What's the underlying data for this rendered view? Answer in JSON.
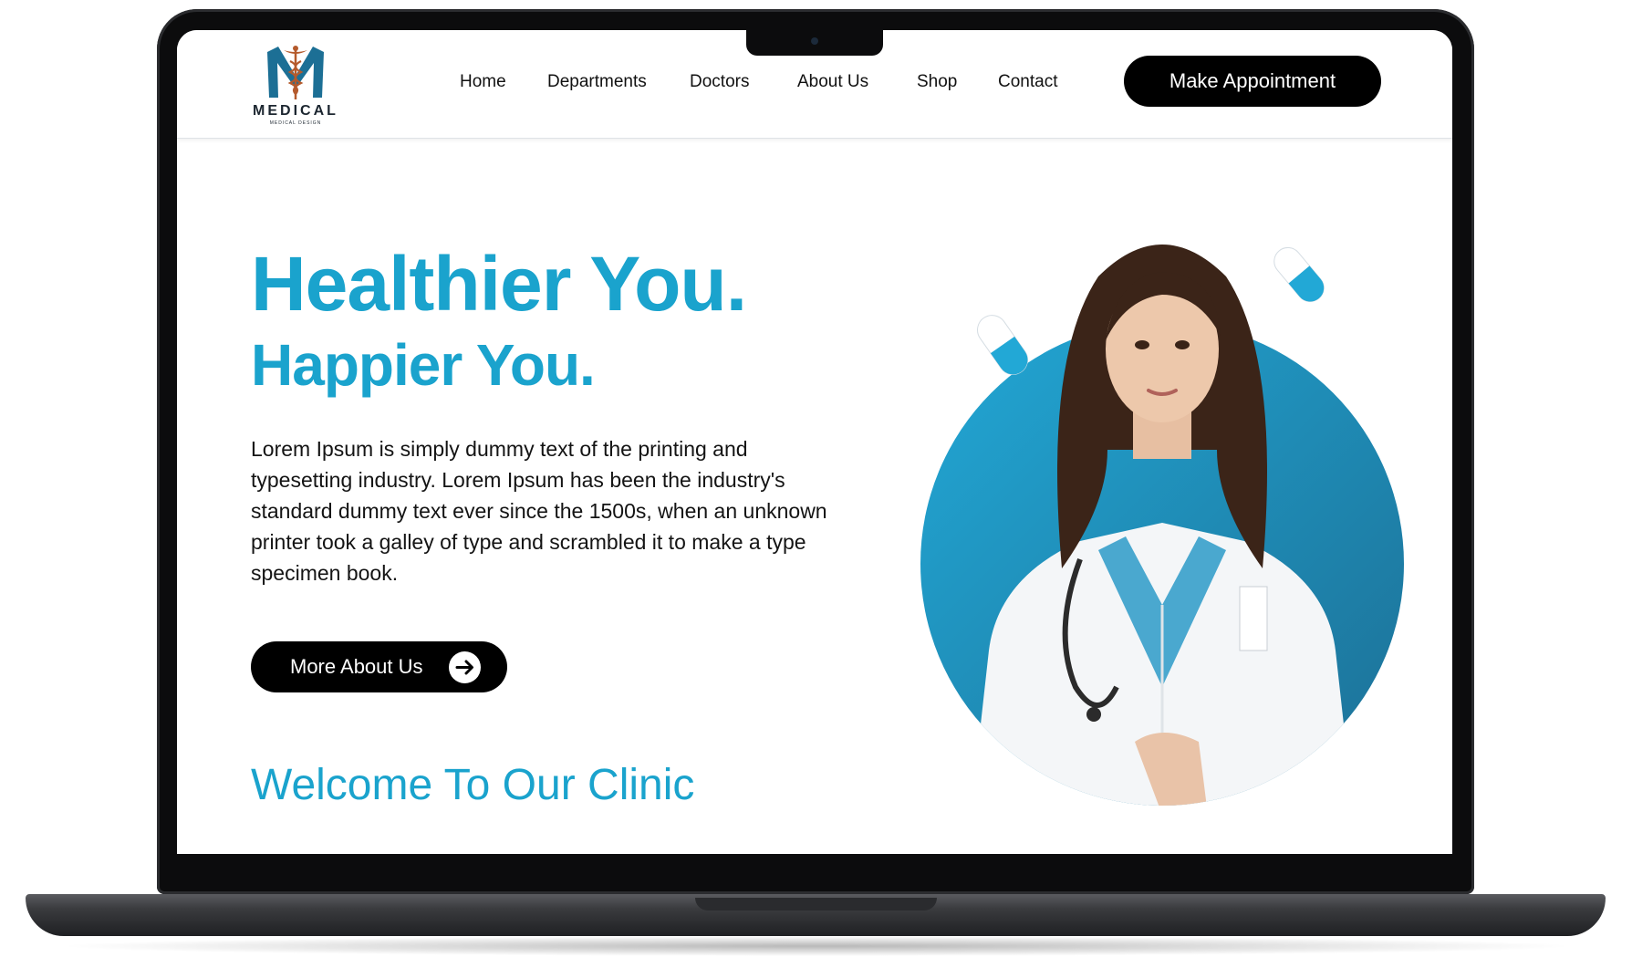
{
  "nav": {
    "logo_name": "MEDICAL",
    "logo_tagline": "MEDICAL DESIGN",
    "items": [
      "Home",
      "Departments",
      "Doctors",
      "About Us",
      "Shop",
      "Contact"
    ],
    "cta_label": "Make Appointment"
  },
  "hero": {
    "title": "Healthier You.",
    "subtitle": "Happier You.",
    "body": "Lorem Ipsum is simply dummy text of the printing and typesetting industry. Lorem Ipsum has been the industry's standard dummy text ever since the 1500s, when an unknown printer took a galley of type and scrambled it to make a type specimen book.",
    "more_label": "More About Us"
  },
  "welcome": {
    "heading": "Welcome To Our Clinic"
  },
  "icons": {
    "logo": "caduceus-icon",
    "more_button": "arrow-right-icon",
    "decoration": "capsule-icon"
  },
  "colors": {
    "accent": "#1aa3cd",
    "accent_dark": "#1c6f95",
    "button": "#000000",
    "button_text": "#ffffff"
  }
}
